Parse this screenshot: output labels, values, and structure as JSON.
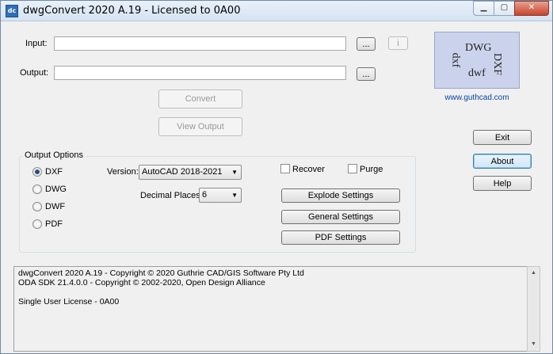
{
  "window": {
    "title": "dwgConvert 2020 A.19 - Licensed to 0A00",
    "app_icon": "dc",
    "controls": {
      "minimize": "▁",
      "maximize": "▢",
      "close": "✕"
    }
  },
  "form": {
    "input_label": "Input:",
    "input_value": "",
    "output_label": "Output:",
    "output_value": "",
    "browse_label": "...",
    "info_label": "i",
    "convert_label": "Convert",
    "view_output_label": "View Output"
  },
  "logo": {
    "words": {
      "dwg": "DWG",
      "dxf_upper": "DXF",
      "dxf_lower": "dxf",
      "dwf": "dwf"
    },
    "link": "www.guthcad.com"
  },
  "side_buttons": {
    "exit": "Exit",
    "about": "About",
    "help": "Help"
  },
  "output_options": {
    "title": "Output Options",
    "formats": [
      {
        "label": "DXF",
        "selected": true
      },
      {
        "label": "DWG",
        "selected": false
      },
      {
        "label": "DWF",
        "selected": false
      },
      {
        "label": "PDF",
        "selected": false
      }
    ],
    "version_label": "Version:",
    "version_value": "AutoCAD 2018-2021",
    "decimal_label": "Decimal Places:",
    "decimal_value": "6",
    "recover_label": "Recover",
    "recover_checked": false,
    "purge_label": "Purge",
    "purge_checked": false,
    "explode_label": "Explode Settings",
    "general_label": "General Settings",
    "pdf_label": "PDF Settings"
  },
  "log": {
    "lines": [
      "dwgConvert 2020 A.19 - Copyright © 2020 Guthrie CAD/GIS Software Pty Ltd",
      "ODA SDK 21.4.0.0 - Copyright © 2002-2020, Open Design Alliance",
      "",
      "Single User License - 0A00"
    ]
  },
  "colors": {
    "accent": "#0645ad",
    "logo_bg": "#cbd3ec",
    "close": "#c7432c"
  }
}
